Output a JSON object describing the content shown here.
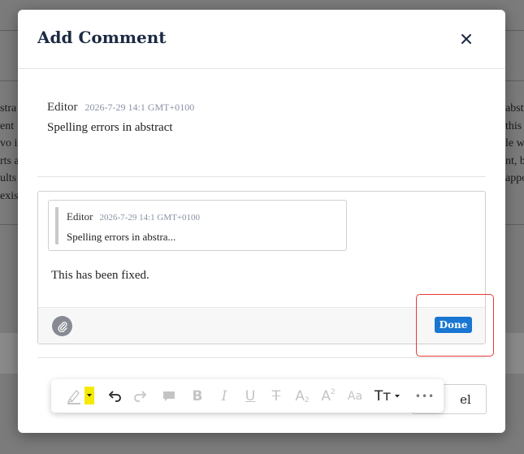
{
  "dialog": {
    "title": "Add Comment",
    "close_icon": "close-icon"
  },
  "original_comment": {
    "author": "Editor",
    "timestamp": "2026-7-29 14:1 GMT+0100",
    "text": "Spelling errors in abstract"
  },
  "reply": {
    "quote": {
      "author": "Editor",
      "timestamp": "2026-7-29 14:1 GMT+0100",
      "text": "Spelling errors in abstra..."
    },
    "text": "This has been fixed.",
    "attach_icon": "paperclip-icon",
    "done_label": "Done"
  },
  "footer": {
    "cancel_label_partial": "el"
  },
  "toolbar": {
    "items": [
      {
        "name": "highlighter-icon"
      },
      {
        "name": "undo-icon"
      },
      {
        "name": "redo-icon"
      },
      {
        "name": "comment-icon"
      },
      {
        "name": "bold-icon",
        "glyph": "B"
      },
      {
        "name": "italic-icon",
        "glyph": "I"
      },
      {
        "name": "underline-icon",
        "glyph": "U"
      },
      {
        "name": "strikethrough-icon",
        "glyph": "T"
      },
      {
        "name": "subscript-icon",
        "glyph": "A",
        "sub": "2"
      },
      {
        "name": "superscript-icon",
        "glyph": "A",
        "sup": "2"
      },
      {
        "name": "font-case-icon",
        "glyph": "Aa"
      },
      {
        "name": "text-size-icon",
        "glyph": "Tт"
      },
      {
        "name": "more-icon",
        "glyph": "•••"
      }
    ],
    "highlight_color": "#f5ea00"
  },
  "background_doc": {
    "left_fragments": [
      "stra",
      "ent",
      "vo ir",
      "rts a",
      "ults",
      "exist"
    ],
    "right_fragments": [
      "abstra",
      "this",
      "le w",
      "nt, b",
      "appo",
      ""
    ]
  },
  "colors": {
    "accent": "#1976d2",
    "title": "#1d2a44",
    "timestamp": "#8891a5",
    "highlight_border": "#e53935"
  }
}
